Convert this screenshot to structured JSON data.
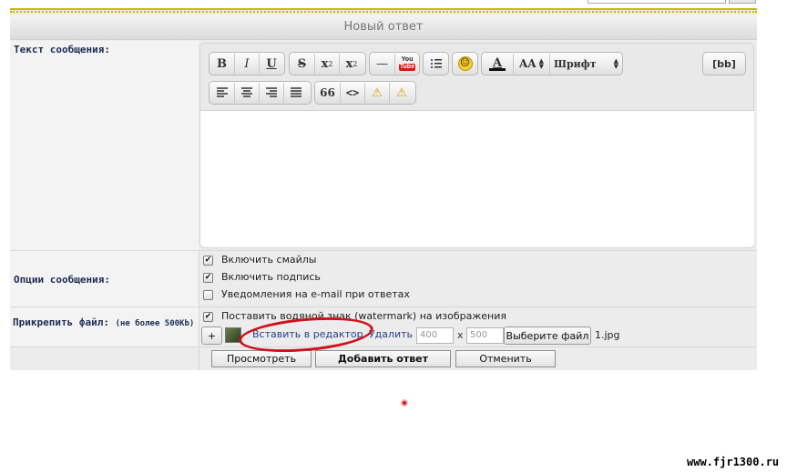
{
  "form": {
    "title": "Новый ответ",
    "message_label": "Текст сообщения:",
    "options_label": "Опции сообщения:",
    "attach_label": "Прикрепить файл:",
    "attach_note": "(не более 500Kb)"
  },
  "toolbar": {
    "bold": "B",
    "italic": "I",
    "underline": "U",
    "strike": "S",
    "superscript_base": "x",
    "superscript_mark": "2",
    "subscript_base": "x",
    "subscript_mark": "2",
    "hr": "—",
    "youtube_top": "You",
    "youtube_bottom": "Tube",
    "smile": "☺",
    "font_color": "A",
    "font_size": "AA",
    "font_family": "Шрифт",
    "bb": "[bb]",
    "quote": "66",
    "code": "<>",
    "spoiler": "⚠",
    "hide": "⚠"
  },
  "options": {
    "smiles": {
      "label": "Включить смайлы",
      "checked": true
    },
    "signature": {
      "label": "Включить подпись",
      "checked": true
    },
    "notify": {
      "label": "Уведомления на e-mail при ответах",
      "checked": false
    }
  },
  "attach": {
    "watermark": {
      "label": "Поставить водяной знак (watermark) на изображения",
      "checked": true
    },
    "add": "+",
    "insert": "Вставить в редактор",
    "delete": "Удалить",
    "width": "400",
    "x": "x",
    "height": "500",
    "choose": "Выберите файл",
    "filename": "1.jpg"
  },
  "buttons": {
    "preview": "Просмотреть",
    "submit": "Добавить ответ",
    "cancel": "Отменить"
  },
  "watermark_site": "www.fjr1300.ru",
  "colors": {
    "gold_rule": "#c9b700",
    "label_blue": "#1d2c55",
    "annotation_red": "#d0101c"
  }
}
